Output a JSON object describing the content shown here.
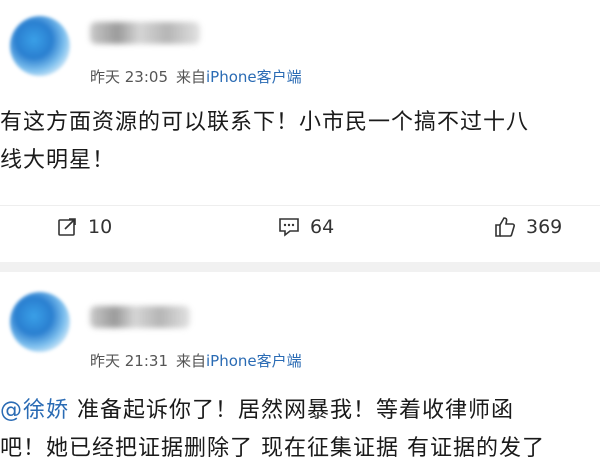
{
  "posts": [
    {
      "time": "昨天 23:05",
      "source_prefix": "来自",
      "source_device": "iPhone客户端",
      "content_lines": [
        "有这方面资源的可以联系下！小市民一个搞不过十八",
        "线大明星！"
      ],
      "actions": {
        "repost": "10",
        "comment": "64",
        "like": "369"
      }
    },
    {
      "time": "昨天 21:31",
      "source_prefix": "来自",
      "source_device": "iPhone客户端",
      "mention": "@徐娇",
      "content_line1_rest": " 准备起诉你了！居然网暴我！等着收律师函",
      "content_line2": "吧！她已经把证据删除了 现在征集证据 有证据的发了"
    }
  ],
  "watermark": "",
  "colors": {
    "link": "#2a6bb4",
    "separator": "#f1f1f1"
  },
  "icons": {
    "repost": "share-icon",
    "comment": "comment-icon",
    "like": "thumbs-up-icon"
  }
}
